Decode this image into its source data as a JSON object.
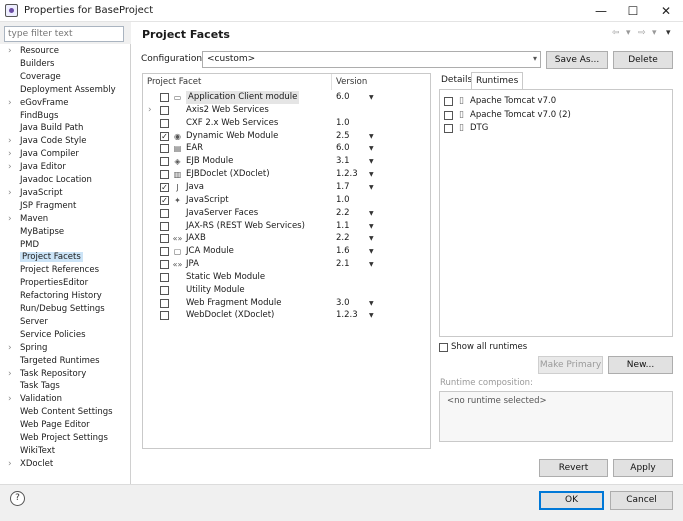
{
  "window": {
    "title": "Properties for BaseProject",
    "minimize": "—",
    "maximize": "☐",
    "close": "✕"
  },
  "sidebar": {
    "filter_placeholder": "type filter text",
    "items": [
      {
        "label": "Resource",
        "expandable": true
      },
      {
        "label": "Builders",
        "expandable": false
      },
      {
        "label": "Coverage",
        "expandable": false
      },
      {
        "label": "Deployment Assembly",
        "expandable": false
      },
      {
        "label": "eGovFrame",
        "expandable": true
      },
      {
        "label": "FindBugs",
        "expandable": false
      },
      {
        "label": "Java Build Path",
        "expandable": false
      },
      {
        "label": "Java Code Style",
        "expandable": true
      },
      {
        "label": "Java Compiler",
        "expandable": true
      },
      {
        "label": "Java Editor",
        "expandable": true
      },
      {
        "label": "Javadoc Location",
        "expandable": false
      },
      {
        "label": "JavaScript",
        "expandable": true
      },
      {
        "label": "JSP Fragment",
        "expandable": false
      },
      {
        "label": "Maven",
        "expandable": true
      },
      {
        "label": "MyBatipse",
        "expandable": false
      },
      {
        "label": "PMD",
        "expandable": false
      },
      {
        "label": "Project Facets",
        "expandable": false,
        "selected": true
      },
      {
        "label": "Project References",
        "expandable": false
      },
      {
        "label": "PropertiesEditor",
        "expandable": false
      },
      {
        "label": "Refactoring History",
        "expandable": false
      },
      {
        "label": "Run/Debug Settings",
        "expandable": false
      },
      {
        "label": "Server",
        "expandable": false
      },
      {
        "label": "Service Policies",
        "expandable": false
      },
      {
        "label": "Spring",
        "expandable": true
      },
      {
        "label": "Targeted Runtimes",
        "expandable": false
      },
      {
        "label": "Task Repository",
        "expandable": true
      },
      {
        "label": "Task Tags",
        "expandable": false
      },
      {
        "label": "Validation",
        "expandable": true
      },
      {
        "label": "Web Content Settings",
        "expandable": false
      },
      {
        "label": "Web Page Editor",
        "expandable": false
      },
      {
        "label": "Web Project Settings",
        "expandable": false
      },
      {
        "label": "WikiText",
        "expandable": false
      },
      {
        "label": "XDoclet",
        "expandable": true
      }
    ]
  },
  "page": {
    "title": "Project Facets",
    "configuration_label": "Configuration:",
    "configuration_value": "<custom>",
    "save_as": "Save As...",
    "delete": "Delete"
  },
  "facets": {
    "col_facet": "Project Facet",
    "col_version": "Version",
    "rows": [
      {
        "name": "Application Client module",
        "version": "6.0",
        "checked": false,
        "dropdown": true,
        "icon": "module-icon",
        "highlight": true,
        "expandable": false
      },
      {
        "name": "Axis2 Web Services",
        "version": "",
        "checked": false,
        "dropdown": false,
        "icon": "",
        "highlight": false,
        "expandable": true
      },
      {
        "name": "CXF 2.x Web Services",
        "version": "1.0",
        "checked": false,
        "dropdown": false,
        "icon": "",
        "highlight": false,
        "expandable": false
      },
      {
        "name": "Dynamic Web Module",
        "version": "2.5",
        "checked": true,
        "dropdown": true,
        "icon": "web-module-icon",
        "highlight": false,
        "expandable": false
      },
      {
        "name": "EAR",
        "version": "6.0",
        "checked": false,
        "dropdown": true,
        "icon": "ear-icon",
        "highlight": false,
        "expandable": false
      },
      {
        "name": "EJB Module",
        "version": "3.1",
        "checked": false,
        "dropdown": true,
        "icon": "ejb-icon",
        "highlight": false,
        "expandable": false
      },
      {
        "name": "EJBDoclet (XDoclet)",
        "version": "1.2.3",
        "checked": false,
        "dropdown": true,
        "icon": "doclet-icon",
        "highlight": false,
        "expandable": false
      },
      {
        "name": "Java",
        "version": "1.7",
        "checked": true,
        "dropdown": true,
        "icon": "java-icon",
        "highlight": false,
        "expandable": false
      },
      {
        "name": "JavaScript",
        "version": "1.0",
        "checked": true,
        "dropdown": false,
        "icon": "javascript-icon",
        "highlight": false,
        "expandable": false
      },
      {
        "name": "JavaServer Faces",
        "version": "2.2",
        "checked": false,
        "dropdown": true,
        "icon": "",
        "highlight": false,
        "expandable": false
      },
      {
        "name": "JAX-RS (REST Web Services)",
        "version": "1.1",
        "checked": false,
        "dropdown": true,
        "icon": "",
        "highlight": false,
        "expandable": false
      },
      {
        "name": "JAXB",
        "version": "2.2",
        "checked": false,
        "dropdown": true,
        "icon": "jaxb-icon",
        "highlight": false,
        "expandable": false
      },
      {
        "name": "JCA Module",
        "version": "1.6",
        "checked": false,
        "dropdown": true,
        "icon": "jca-icon",
        "highlight": false,
        "expandable": false
      },
      {
        "name": "JPA",
        "version": "2.1",
        "checked": false,
        "dropdown": true,
        "icon": "jpa-icon",
        "highlight": false,
        "expandable": false
      },
      {
        "name": "Static Web Module",
        "version": "",
        "checked": false,
        "dropdown": false,
        "icon": "",
        "highlight": false,
        "expandable": false
      },
      {
        "name": "Utility Module",
        "version": "",
        "checked": false,
        "dropdown": false,
        "icon": "",
        "highlight": false,
        "expandable": false
      },
      {
        "name": "Web Fragment Module",
        "version": "3.0",
        "checked": false,
        "dropdown": true,
        "icon": "",
        "highlight": false,
        "expandable": false
      },
      {
        "name": "WebDoclet (XDoclet)",
        "version": "1.2.3",
        "checked": false,
        "dropdown": true,
        "icon": "",
        "highlight": false,
        "expandable": false
      }
    ]
  },
  "right": {
    "tab_details": "Details",
    "tab_runtimes": "Runtimes",
    "runtimes": [
      {
        "label": "Apache Tomcat v7.0",
        "checked": false
      },
      {
        "label": "Apache Tomcat v7.0 (2)",
        "checked": false
      },
      {
        "label": "DTG",
        "checked": false
      }
    ],
    "show_all": "Show all runtimes",
    "make_primary": "Make Primary",
    "new": "New...",
    "composition_label": "Runtime composition:",
    "composition_value": "<no runtime selected>"
  },
  "footer": {
    "revert": "Revert",
    "apply": "Apply",
    "ok": "OK",
    "cancel": "Cancel",
    "help": "?"
  },
  "nav_arrows": {
    "back": "⇦",
    "fwd": "⇨",
    "menu": "▾"
  }
}
